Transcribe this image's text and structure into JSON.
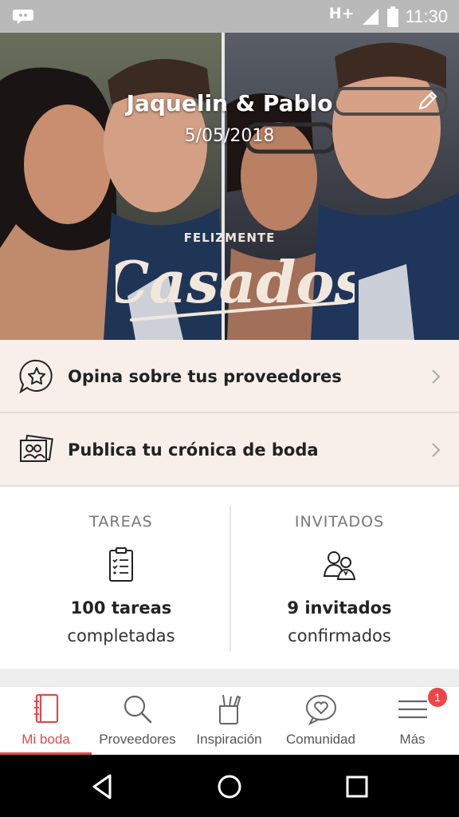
{
  "status_bar": {
    "network": "H+",
    "time": "11:30",
    "icons": [
      "chat-bubble-icon",
      "signal-icon",
      "battery-icon"
    ]
  },
  "hero": {
    "couple_names": "Jaquelin & Pablo",
    "date": "5/05/2018",
    "stamp_small": "FELIZMENTE",
    "stamp_big": "Casados",
    "edit_icon": "pencil-icon"
  },
  "actions": [
    {
      "label": "Opina sobre tus proveedores",
      "icon": "star-speech-bubble-icon"
    },
    {
      "label": "Publica tu crónica de boda",
      "icon": "photos-icon"
    }
  ],
  "stats": {
    "tareas": {
      "heading": "TAREAS",
      "value": "100 tareas",
      "caption": "completadas",
      "icon": "clipboard-checklist-icon"
    },
    "invitados": {
      "heading": "INVITADOS",
      "value": "9 invitados",
      "caption": "confirmados",
      "icon": "guests-icon"
    }
  },
  "bottom_nav": {
    "items": [
      {
        "label": "Mi boda",
        "icon": "notebook-icon",
        "active": true
      },
      {
        "label": "Proveedores",
        "icon": "search-icon",
        "active": false
      },
      {
        "label": "Inspiración",
        "icon": "pencil-cup-icon",
        "active": false
      },
      {
        "label": "Comunidad",
        "icon": "heart-bubble-icon",
        "active": false
      },
      {
        "label": "Más",
        "icon": "menu-icon",
        "active": false
      }
    ],
    "badge_count": "1"
  },
  "colors": {
    "accent": "#e04a4c",
    "action_row_bg": "#f8efea",
    "badge": "#ee4545"
  }
}
